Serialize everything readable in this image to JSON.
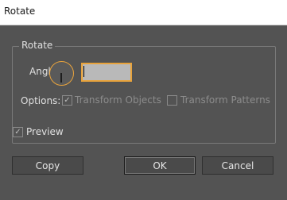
{
  "window": {
    "title": "Rotate"
  },
  "group": {
    "title": "Rotate"
  },
  "angle": {
    "label": "Angle:",
    "value": ""
  },
  "options": {
    "label": "Options:",
    "transform_objects": {
      "label": "Transform Objects",
      "checked": true,
      "enabled": false
    },
    "transform_patterns": {
      "label": "Transform Patterns",
      "checked": false,
      "enabled": false
    }
  },
  "preview": {
    "label": "Preview",
    "checked": true
  },
  "buttons": {
    "copy": "Copy",
    "ok": "OK",
    "cancel": "Cancel"
  },
  "colors": {
    "dialog_bg": "#535353",
    "accent": "#e8a33c"
  }
}
